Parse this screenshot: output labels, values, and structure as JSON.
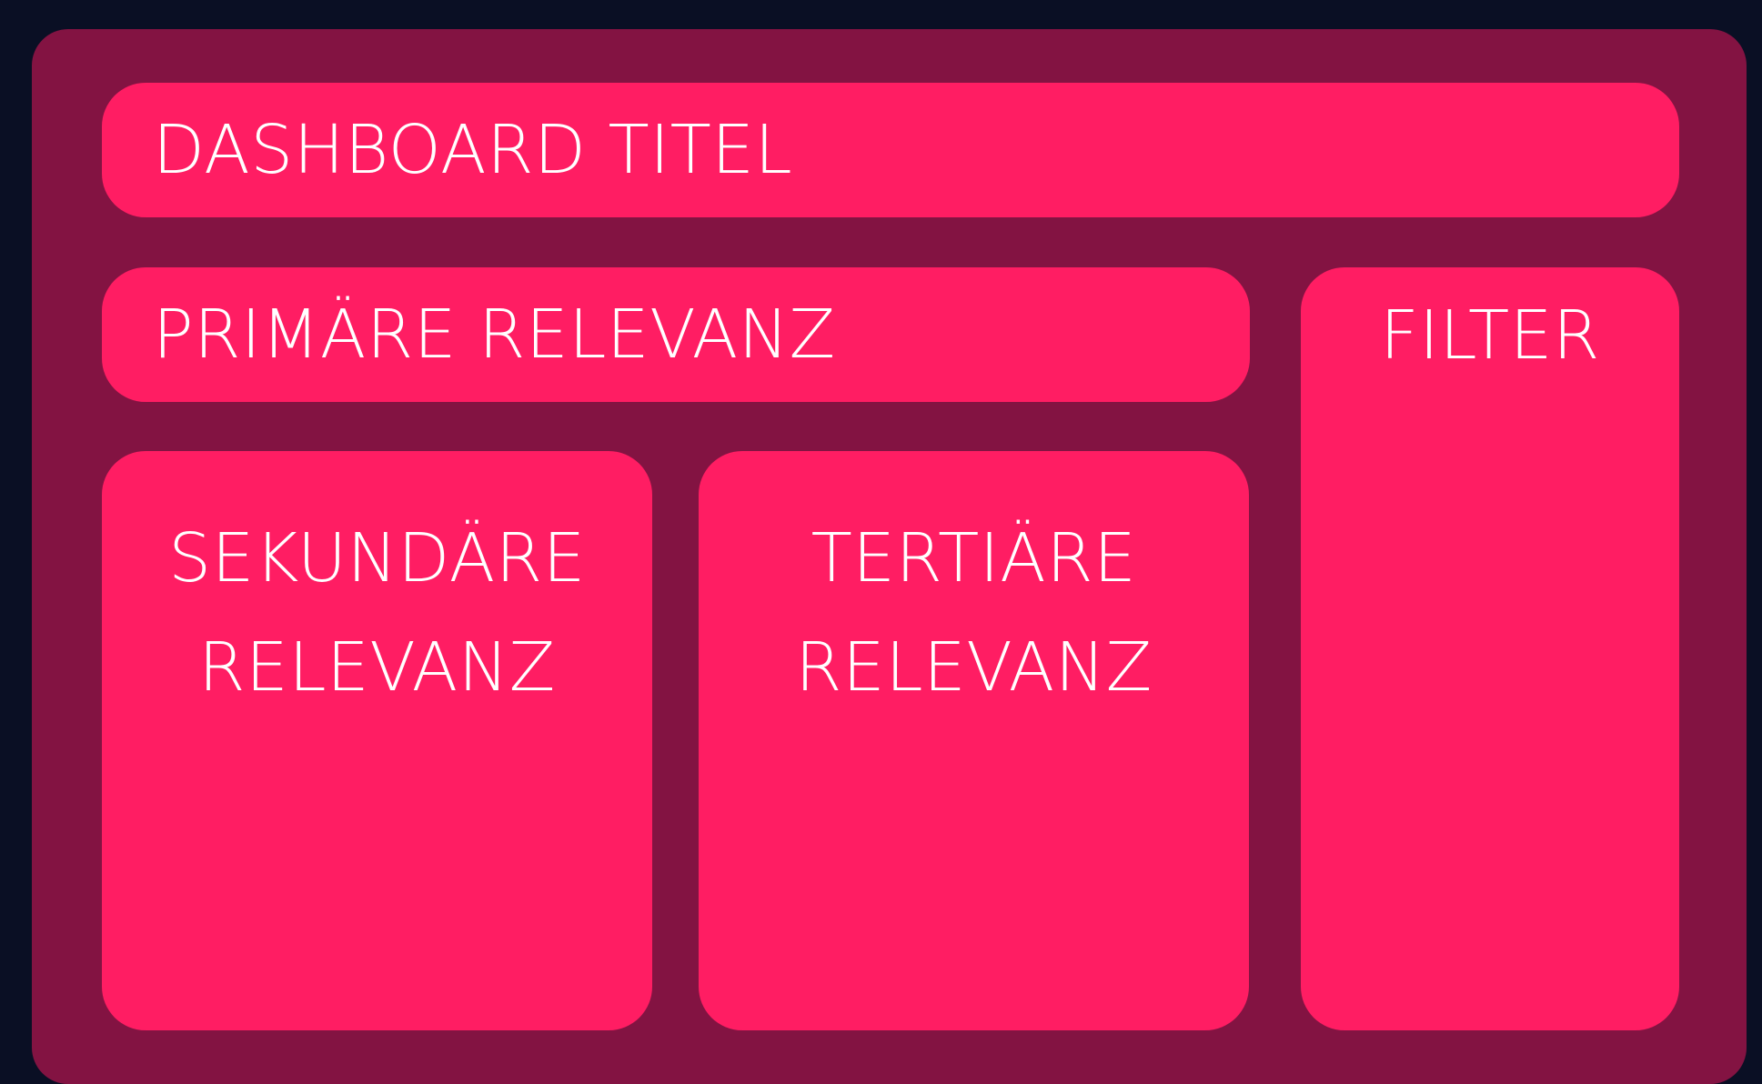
{
  "colors": {
    "background": "#0a0f24",
    "frame": "#831342",
    "box": "#ff1d63",
    "text": "#ffffff"
  },
  "header": {
    "title": "DASHBOARD TITEL"
  },
  "sections": {
    "primary": "PRIMÄRE RELEVANZ",
    "filter": "FILTER",
    "secondary": {
      "line1": "SEKUNDÄRE",
      "line2": "RELEVANZ"
    },
    "tertiary": {
      "line1": "TERTIÄRE",
      "line2": "RELEVANZ"
    }
  }
}
